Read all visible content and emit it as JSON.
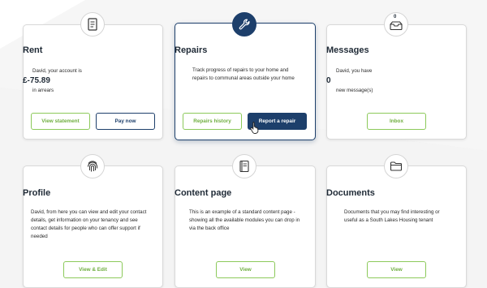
{
  "cards": {
    "rent": {
      "title": "Rent",
      "line1": "David, your account is",
      "amount": "£-75.89",
      "line2": "in arrears",
      "btn_statement": "View statement",
      "btn_pay": "Pay now",
      "icon": "document-icon"
    },
    "repairs": {
      "title": "Repairs",
      "text": "Track progress of repairs to your home and repairs to communal areas outside your home",
      "btn_history": "Repairs history",
      "btn_report": "Report a repair",
      "icon": "wrench-icon"
    },
    "messages": {
      "title": "Messages",
      "line1": "David, you have",
      "count": "0",
      "line2": "new message(s)",
      "btn_inbox": "Inbox",
      "badge": "0",
      "icon": "inbox-icon"
    },
    "profile": {
      "title": "Profile",
      "text": "David, from here you can view and edit your contact details, get information on your tenancy and see contact details for people who can offer support if needed",
      "btn": "View & Edit",
      "icon": "fingerprint-icon"
    },
    "content": {
      "title": "Content page",
      "text": "This is an example of a standard content page - showing all the available modules you can drop in via the back office",
      "btn": "View",
      "icon": "book-icon"
    },
    "documents": {
      "title": "Documents",
      "text": "Documents that you may find interesting or useful as a South Lakes Housing tenant",
      "btn": "View",
      "icon": "folder-icon"
    }
  },
  "colors": {
    "navy": "#1d3f6b",
    "green": "#8cc95a",
    "green_text": "#6fae3f"
  }
}
